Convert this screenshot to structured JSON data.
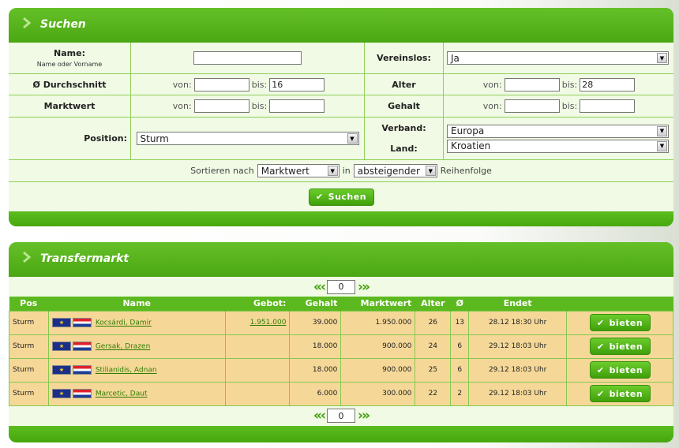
{
  "search": {
    "title": "Suchen",
    "name_label": "Name:",
    "name_sub": "Name oder Vorname",
    "name_value": "",
    "vereinslos_label": "Vereinslos:",
    "vereinslos_value": "Ja",
    "avg_label": "Ø Durchschnitt",
    "von": "von:",
    "bis": "bis:",
    "avg_from": "",
    "avg_to": "16",
    "alter_label": "Alter",
    "alter_from": "",
    "alter_to": "28",
    "marktwert_label": "Marktwert",
    "mw_from": "",
    "mw_to": "",
    "gehalt_label": "Gehalt",
    "gehalt_from": "",
    "gehalt_to": "",
    "position_label": "Position:",
    "position_value": "Sturm",
    "verband_label": "Verband:",
    "verband_value": "Europa",
    "land_label": "Land:",
    "land_value": "Kroatien",
    "sort_prefix": "Sortieren nach",
    "sort_value": "Marktwert",
    "sort_in": "in",
    "order_value": "absteigender",
    "order_suffix": "Reihenfolge",
    "submit_label": "Suchen"
  },
  "market": {
    "title": "Transfermarkt",
    "page": "0",
    "headers": [
      "Pos",
      "Name",
      "Gebot:",
      "Gehalt",
      "Marktwert",
      "Alter",
      "Ø",
      "Endet",
      ""
    ],
    "bid_label": "bieten",
    "rows": [
      {
        "pos": "Sturm",
        "name": "Kocsárdi, Damir",
        "gebot": "1.951.000",
        "gehalt": "39.000",
        "marktwert": "1.950.000",
        "alter": "26",
        "avg": "13",
        "endet": "28.12 18:30 Uhr"
      },
      {
        "pos": "Sturm",
        "name": "Gersak, Drazen",
        "gebot": "",
        "gehalt": "18.000",
        "marktwert": "900.000",
        "alter": "24",
        "avg": "6",
        "endet": "29.12 18:03 Uhr"
      },
      {
        "pos": "Sturm",
        "name": "Stilianidis, Adnan",
        "gebot": "",
        "gehalt": "18.000",
        "marktwert": "900.000",
        "alter": "25",
        "avg": "6",
        "endet": "29.12 18:03 Uhr"
      },
      {
        "pos": "Sturm",
        "name": "Marcetic, Daut",
        "gebot": "",
        "gehalt": "6.000",
        "marktwert": "300.000",
        "alter": "22",
        "avg": "2",
        "endet": "29.12 18:03 Uhr"
      }
    ]
  },
  "colors": {
    "accent_green": "#48a80f",
    "row_bg": "#f5d898",
    "form_bg": "#f0fae4"
  },
  "icons": {
    "panel": "chevron-right-icon",
    "button": "check-icon",
    "pager_first": "double-chevron-left-icon",
    "pager_prev": "chevron-left-icon",
    "pager_next": "chevron-right-icon",
    "pager_last": "double-chevron-right-icon",
    "flags": [
      "eu-flag-icon",
      "croatia-flag-icon"
    ]
  }
}
